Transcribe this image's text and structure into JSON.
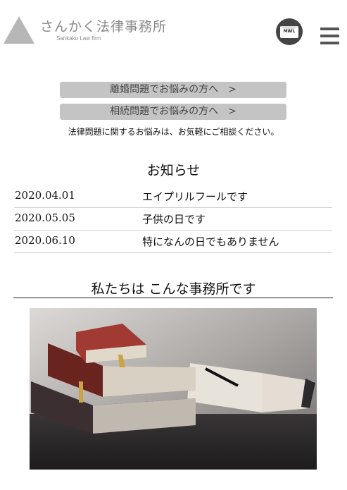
{
  "header": {
    "logo_title": "さんかく法律事務所",
    "logo_subtitle": "Sankaku Law firm",
    "mail_label": "MAIL"
  },
  "cta": {
    "divorce": "離婚問題でお悩みの方へ　>",
    "inheritance": "相続問題でお悩みの方へ　>",
    "lead": "法律問題に関するお悩みは、お気軽にご相談ください。"
  },
  "news": {
    "heading": "お知らせ",
    "items": [
      {
        "date": "2020.04.01",
        "text": "エイプリルフールです"
      },
      {
        "date": "2020.05.05",
        "text": "子供の日です"
      },
      {
        "date": "2020.06.10",
        "text": "特になんの日でもありません"
      }
    ]
  },
  "about": {
    "heading": "私たちは こんな事務所です"
  },
  "colors": {
    "button_bg": "#c4c4c4",
    "logo_gray": "#8a8a8a"
  }
}
